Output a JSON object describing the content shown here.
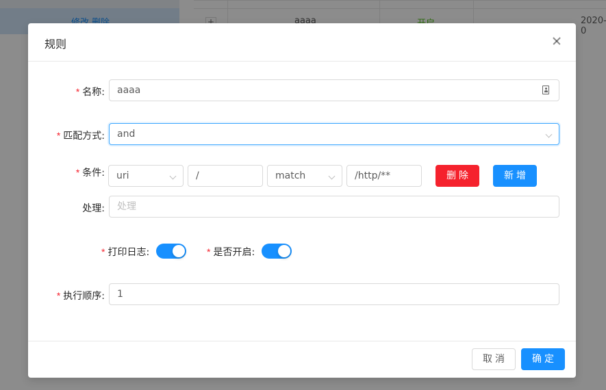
{
  "background": {
    "left_actions": "修改  删除",
    "row": {
      "expand": "+",
      "name": "aaaa",
      "status": "开启",
      "date": "2020-0"
    }
  },
  "modal": {
    "title": "规则",
    "form": {
      "name": {
        "label": "名称",
        "value": "aaaa",
        "required": true
      },
      "match_mode": {
        "label": "匹配方式",
        "value": "and",
        "required": true
      },
      "condition": {
        "label": "条件",
        "required": true,
        "param_type": "uri",
        "param_name": "/",
        "operator": "match",
        "param_value": "/http/**",
        "delete_label": "删除",
        "add_label": "新增"
      },
      "handle": {
        "label": "处理",
        "placeholder": "处理"
      },
      "log": {
        "label": "打印日志",
        "required": true,
        "on": true
      },
      "enabled": {
        "label": "是否开启",
        "required": true,
        "on": true
      },
      "sort": {
        "label": "执行顺序",
        "value": "1",
        "required": true
      }
    },
    "footer": {
      "cancel_label": "取消",
      "ok_label": "确定"
    }
  },
  "colors": {
    "primary": "#1890ff",
    "danger": "#f5222d",
    "required": "#f5222d"
  },
  "icons": {
    "close": "close-icon",
    "chevron": "chevron-down-icon",
    "contact": "contact-card-icon"
  }
}
